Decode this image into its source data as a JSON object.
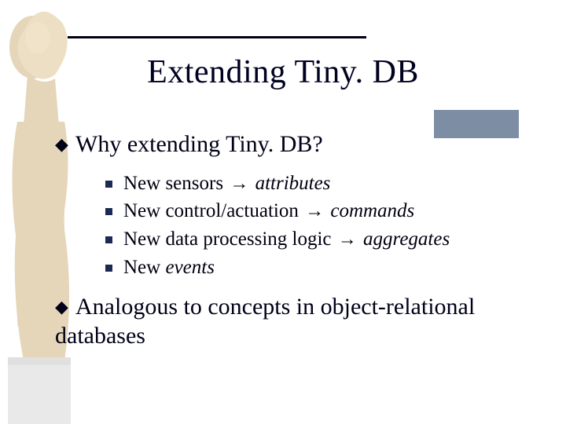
{
  "title": "Extending Tiny. DB",
  "arrow": "→",
  "bullets": [
    {
      "text": "Why extending Tiny. DB?",
      "sub": [
        {
          "pre": "New sensors",
          "post": "attributes"
        },
        {
          "pre": "New control/actuation",
          "post": "commands"
        },
        {
          "pre": "New data processing logic",
          "post": "aggregates"
        },
        {
          "pre": "New",
          "post": "events"
        }
      ]
    },
    {
      "text": "Analogous to concepts in object-relational databases"
    }
  ]
}
